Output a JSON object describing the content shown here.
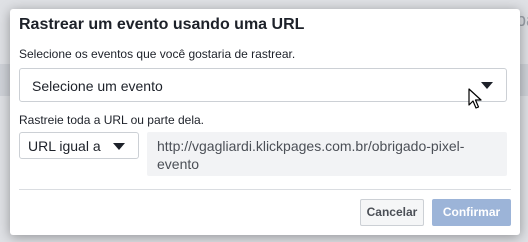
{
  "background": {
    "partial_text": "pa"
  },
  "dialog": {
    "title": "Rastrear um evento usando uma URL",
    "event_label": "Selecione os eventos que você gostaria de rastrear.",
    "event_select": {
      "selected": "Selecione um evento",
      "icon": "chevron-down-icon"
    },
    "rule_label": "Rastreie toda a URL ou parte dela.",
    "rule_select": {
      "selected": "URL igual a",
      "icon": "chevron-down-icon"
    },
    "url_value": "http://vgagliardi.klickpages.com.br/obrigado-pixel-evento",
    "cancel_label": "Cancelar",
    "confirm_label": "Confirmar",
    "colors": {
      "confirm_disabled": "#9cb4d8",
      "text": "#1d2129"
    }
  },
  "cursor": {
    "icon": "mouse-pointer-icon"
  }
}
